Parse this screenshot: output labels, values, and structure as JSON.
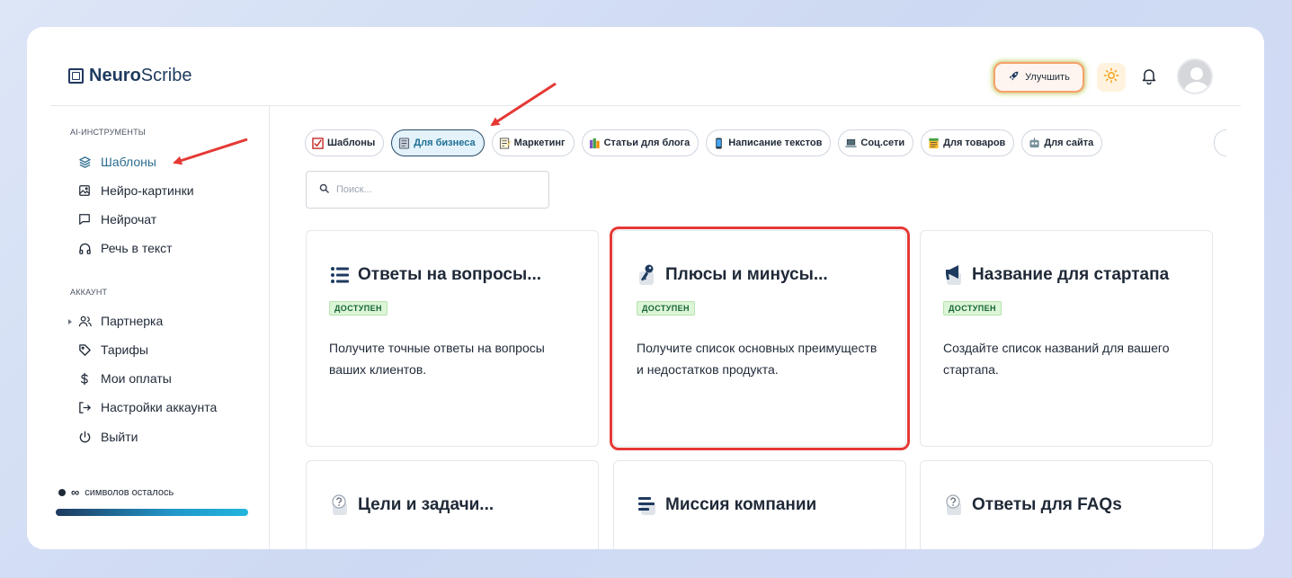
{
  "header": {
    "logo_bold": "Neuro",
    "logo_regular": "Scribe",
    "upgrade_label": "Улучшить"
  },
  "sidebar": {
    "section_tools": "AI-ИНСТРУМЕНТЫ",
    "tools": [
      {
        "label": "Шаблоны",
        "icon": "layers-icon",
        "active": true
      },
      {
        "label": "Нейро-картинки",
        "icon": "image-icon"
      },
      {
        "label": "Нейрочат",
        "icon": "chat-icon"
      },
      {
        "label": "Речь в текст",
        "icon": "headphones-icon"
      }
    ],
    "section_account": "АККАУНТ",
    "account": [
      {
        "label": "Партнерка",
        "icon": "users-icon"
      },
      {
        "label": "Тарифы",
        "icon": "tag-icon"
      },
      {
        "label": "Мои оплаты",
        "icon": "dollar-icon"
      },
      {
        "label": "Настройки аккаунта",
        "icon": "logout-arrow-icon"
      },
      {
        "label": "Выйти",
        "icon": "power-icon"
      }
    ],
    "quota_value": "∞",
    "quota_label": "символов осталось"
  },
  "categories": [
    {
      "label": "Шаблоны",
      "icon": "checkbox-icon",
      "color": "#e53935"
    },
    {
      "label": "Для бизнеса",
      "icon": "notebook-icon",
      "color": "#8d9aa8",
      "active": true
    },
    {
      "label": "Маркетинг",
      "icon": "memo-icon",
      "color": "#f4c542"
    },
    {
      "label": "Статьи для блога",
      "icon": "books-icon",
      "color": "#7e57c2"
    },
    {
      "label": "Написание текстов",
      "icon": "phone-icon",
      "color": "#1e88e5"
    },
    {
      "label": "Соц.сети",
      "icon": "laptop-icon",
      "color": "#37474f"
    },
    {
      "label": "Для товаров",
      "icon": "ledger-icon",
      "color": "#43a047"
    },
    {
      "label": "Для сайта",
      "icon": "robot-icon",
      "color": "#546e7a"
    }
  ],
  "search": {
    "placeholder": "Поиск..."
  },
  "cards": [
    {
      "title": "Ответы на вопросы...",
      "icon": "list-icon",
      "badge": "ДОСТУПЕН",
      "desc": "Получите точные ответы на вопросы ваших клиентов."
    },
    {
      "title": "Плюсы и минусы...",
      "icon": "key-icon",
      "badge": "ДОСТУПЕН",
      "desc": "Получите список основных преимуществ и недостатков продукта.",
      "highlighted": true
    },
    {
      "title": "Название для стартапа",
      "icon": "megaphone-icon",
      "badge": "ДОСТУПЕН",
      "desc": "Создайте список названий для вашего стартапа."
    },
    {
      "title": "Цели и задачи...",
      "icon": "question-icon"
    },
    {
      "title": "Миссия компании",
      "icon": "text-lines-icon"
    },
    {
      "title": "Ответы для FAQs",
      "icon": "question-icon"
    }
  ],
  "colors": {
    "accent": "#2c6e8f",
    "annotation": "#e53935",
    "badge_bg": "#dcf5d7"
  }
}
